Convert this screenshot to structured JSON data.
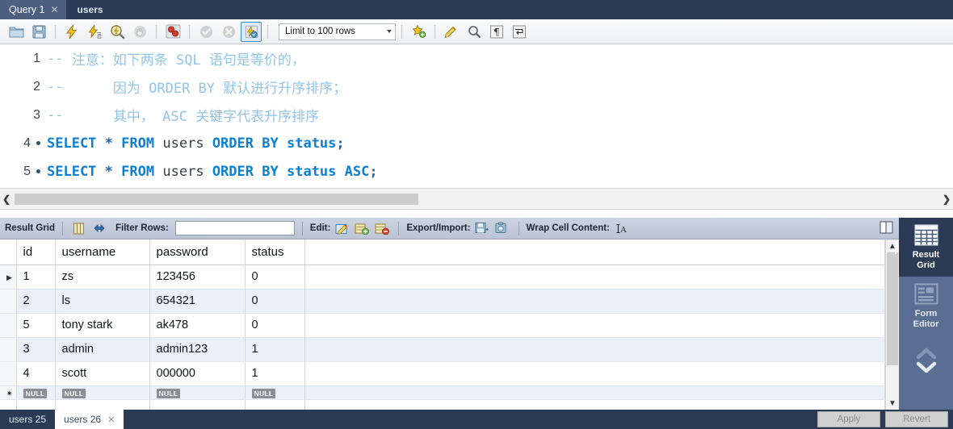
{
  "window": {
    "top_tabs": [
      {
        "label": "Query 1",
        "active": true,
        "closable": true
      },
      {
        "label": "users",
        "active": false,
        "closable": false
      }
    ]
  },
  "editor_toolbar": {
    "buttons": [
      {
        "name": "open-sql-file-icon",
        "label": "Open SQL Script File"
      },
      {
        "name": "save-sql-file-icon",
        "label": "Save SQL Script File"
      },
      {
        "name": "execute-statement-icon",
        "label": "Execute"
      },
      {
        "name": "execute-current-statement-icon",
        "label": "Execute Current Statement"
      },
      {
        "name": "explain-statement-icon",
        "label": "Explain Current Statement"
      },
      {
        "name": "stop-statement-icon",
        "label": "Stop"
      },
      {
        "name": "toggle-breakpoint-icon",
        "label": "Toggle Breakpoint"
      },
      {
        "name": "commit-icon",
        "label": "Commit"
      },
      {
        "name": "rollback-icon",
        "label": "Rollback"
      },
      {
        "name": "autocommit-icon",
        "label": "Toggle Autocommit"
      },
      {
        "name": "beautify-sql-icon",
        "label": "Beautify SQL"
      },
      {
        "name": "find-icon",
        "label": "Find"
      },
      {
        "name": "toggle-invisible-chars-icon",
        "label": "Show Invisible Characters"
      },
      {
        "name": "toggle-wrapping-icon",
        "label": "Toggle Wrapping"
      }
    ],
    "limit_select": {
      "value": "Limit to 100 rows",
      "count": "100"
    }
  },
  "sql_editor": {
    "lines": [
      {
        "number": "1",
        "marker": false,
        "tokens": [
          {
            "t": "-- ",
            "c": "cmt"
          },
          {
            "t": "注意：如下两条 SQL 语句是等价的，",
            "c": "cmt"
          }
        ]
      },
      {
        "number": "2",
        "marker": false,
        "tokens": [
          {
            "t": "--      ",
            "c": "cmt"
          },
          {
            "t": "因为 ORDER BY 默认进行升序排序；",
            "c": "cmt"
          }
        ]
      },
      {
        "number": "3",
        "marker": false,
        "tokens": [
          {
            "t": "--      ",
            "c": "cmt"
          },
          {
            "t": "其中， ASC 关键字代表升序排序",
            "c": "cmt"
          }
        ]
      },
      {
        "number": "4",
        "marker": true,
        "tokens": [
          {
            "t": "SELECT",
            "c": "kw"
          },
          {
            "t": " ",
            "c": "idn"
          },
          {
            "t": "*",
            "c": "pun"
          },
          {
            "t": " ",
            "c": "idn"
          },
          {
            "t": "FROM",
            "c": "kw"
          },
          {
            "t": " ",
            "c": "idn"
          },
          {
            "t": "users",
            "c": "idn"
          },
          {
            "t": " ",
            "c": "idn"
          },
          {
            "t": "ORDER",
            "c": "kw"
          },
          {
            "t": " ",
            "c": "idn"
          },
          {
            "t": "BY",
            "c": "kw"
          },
          {
            "t": " ",
            "c": "idn"
          },
          {
            "t": "status",
            "c": "kw"
          },
          {
            "t": ";",
            "c": "pun"
          }
        ]
      },
      {
        "number": "5",
        "marker": true,
        "tokens": [
          {
            "t": "SELECT",
            "c": "kw"
          },
          {
            "t": " ",
            "c": "idn"
          },
          {
            "t": "*",
            "c": "pun"
          },
          {
            "t": " ",
            "c": "idn"
          },
          {
            "t": "FROM",
            "c": "kw"
          },
          {
            "t": " ",
            "c": "idn"
          },
          {
            "t": "users",
            "c": "idn"
          },
          {
            "t": " ",
            "c": "idn"
          },
          {
            "t": "ORDER",
            "c": "kw"
          },
          {
            "t": " ",
            "c": "idn"
          },
          {
            "t": "BY",
            "c": "kw"
          },
          {
            "t": " ",
            "c": "idn"
          },
          {
            "t": "status",
            "c": "kw"
          },
          {
            "t": " ",
            "c": "idn"
          },
          {
            "t": "ASC",
            "c": "kw"
          },
          {
            "t": ";",
            "c": "pun"
          }
        ]
      }
    ]
  },
  "result_toolbar": {
    "title": "Result Grid",
    "filter_label": "Filter Rows:",
    "filter_value": "",
    "filter_placeholder": "",
    "edit_label": "Edit:",
    "export_label": "Export/Import:",
    "wrap_label": "Wrap Cell Content:",
    "icons": {
      "grid_view": "grid-view-icon",
      "refresh": "refresh-icon",
      "edit_cell": "edit-cell-icon",
      "insert_row": "insert-row-icon",
      "delete_row": "delete-row-icon",
      "export_recordset": "export-recordset-icon",
      "import_recordset": "import-recordset-icon",
      "wrap_cell": "wrap-cell-icon",
      "panel_toggle": "toggle-side-panel-icon"
    }
  },
  "result_grid": {
    "columns": [
      "id",
      "username",
      "password",
      "status"
    ],
    "rows": [
      {
        "cells": [
          "1",
          "zs",
          "123456",
          "0"
        ],
        "marker": "current"
      },
      {
        "cells": [
          "2",
          "ls",
          "654321",
          "0"
        ],
        "marker": ""
      },
      {
        "cells": [
          "5",
          "tony stark",
          "ak478",
          "0"
        ],
        "marker": ""
      },
      {
        "cells": [
          "3",
          "admin",
          "admin123",
          "1"
        ],
        "marker": ""
      },
      {
        "cells": [
          "4",
          "scott",
          "000000",
          "1"
        ],
        "marker": ""
      }
    ],
    "new_row": {
      "cells": [
        "NULL",
        "NULL",
        "NULL",
        "NULL"
      ],
      "marker": "new"
    },
    "null_text": "NULL"
  },
  "side_panel": {
    "items": [
      {
        "label_line1": "Result",
        "label_line2": "Grid",
        "icon": "result-grid-icon",
        "active": true
      },
      {
        "label_line1": "Form",
        "label_line2": "Editor",
        "icon": "form-editor-icon",
        "active": false
      }
    ],
    "nav": {
      "up": "chevron-up-icon",
      "down": "chevron-down-icon"
    }
  },
  "bottom_bar": {
    "tabs": [
      {
        "label": "users 25",
        "active": false,
        "closable": false
      },
      {
        "label": "users 26",
        "active": true,
        "closable": true
      }
    ],
    "apply_label": "Apply",
    "revert_label": "Revert"
  },
  "colors": {
    "chrome_dark": "#2b3b55",
    "tab_active": "#4c5f80",
    "keyword_blue": "#0a7fd4",
    "comment_blue": "#93c4e8",
    "row_alt": "#eaf0fa",
    "panel_blue": "#5a6e93"
  }
}
